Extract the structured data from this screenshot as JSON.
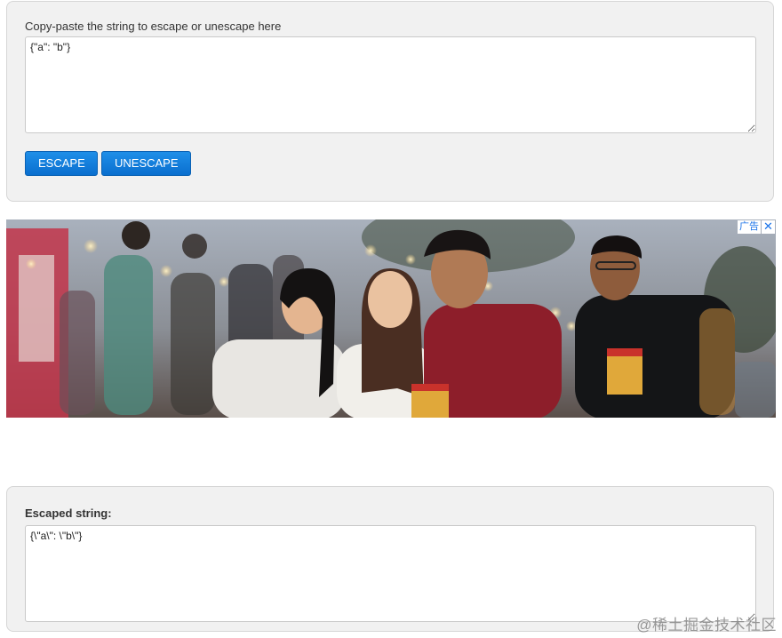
{
  "input_panel": {
    "label": "Copy-paste the string to escape or unescape here",
    "textarea_value": "{\"a\": \"b\"}",
    "buttons": {
      "escape": "ESCAPE",
      "unescape": "UNESCAPE"
    }
  },
  "ad": {
    "tag_label": "广告",
    "close_glyph": "✕"
  },
  "output_panel": {
    "label": "Escaped string:",
    "textarea_value": "{\\\"a\\\": \\\"b\\\"}"
  },
  "watermark": "@稀土掘金技术社区",
  "colors": {
    "button_blue": "#0a6fcf",
    "panel_bg": "#f1f1f1",
    "ad_tag_blue": "#1a73e8"
  }
}
